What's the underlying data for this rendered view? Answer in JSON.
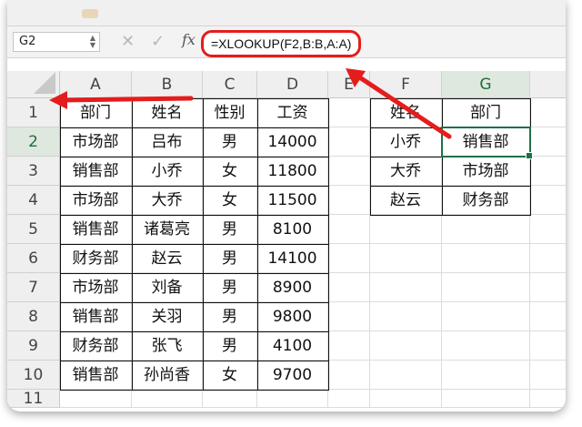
{
  "formula_bar": {
    "name_box": "G2",
    "cancel_icon": "✕",
    "enter_icon": "✓",
    "fx_label": "fx",
    "formula": "=XLOOKUP(F2,B:B,A:A)"
  },
  "sheet": {
    "columns": [
      "A",
      "B",
      "C",
      "D",
      "E",
      "F",
      "G"
    ],
    "rows": [
      "1",
      "2",
      "3",
      "4",
      "5",
      "6",
      "7",
      "8",
      "9",
      "10",
      "11"
    ],
    "selected_cell": "G2",
    "cells": {
      "A": [
        "部门",
        "市场部",
        "销售部",
        "市场部",
        "销售部",
        "财务部",
        "市场部",
        "销售部",
        "财务部",
        "销售部"
      ],
      "B": [
        "姓名",
        "吕布",
        "小乔",
        "大乔",
        "诸葛亮",
        "赵云",
        "刘备",
        "关羽",
        "张飞",
        "孙尚香"
      ],
      "C": [
        "性别",
        "男",
        "女",
        "女",
        "男",
        "男",
        "男",
        "男",
        "男",
        "女"
      ],
      "D": [
        "工资",
        "14000",
        "11800",
        "11500",
        "8100",
        "14100",
        "8900",
        "9800",
        "4100",
        "9700"
      ],
      "F": [
        "姓名",
        "小乔",
        "大乔",
        "赵云"
      ],
      "G": [
        "部门",
        "销售部",
        "市场部",
        "财务部"
      ]
    }
  },
  "annotation": {
    "color": "#e51c1c"
  }
}
